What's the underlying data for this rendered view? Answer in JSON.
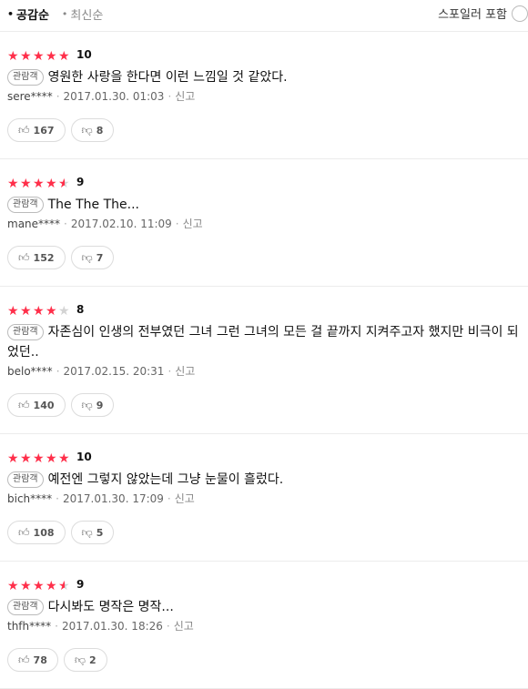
{
  "sort": {
    "active": "공감순",
    "inactive": "최신순",
    "dot": "•"
  },
  "spoiler": {
    "label": "스포일러 포함"
  },
  "colors": {
    "star": "#ff2f4a",
    "empty_star": "#d3d3d3"
  },
  "reviews": [
    {
      "score": "10",
      "rating": 5,
      "badge": "관람객",
      "text": "영원한 사랑을 한다면 이런 느낌일 것 같았다.",
      "user": "sere****",
      "date": "2017.01.30. 01:03",
      "report": "신고",
      "likes": "167",
      "dislikes": "8"
    },
    {
      "score": "9",
      "rating": 4.5,
      "badge": "관람객",
      "text": "The The The...",
      "user": "mane****",
      "date": "2017.02.10. 11:09",
      "report": "신고",
      "likes": "152",
      "dislikes": "7"
    },
    {
      "score": "8",
      "rating": 4,
      "badge": "관람객",
      "text": "자존심이 인생의 전부였던 그녀 그런 그녀의 모든 걸 끝까지 지켜주고자 했지만 비극이 되었던..",
      "user": "belo****",
      "date": "2017.02.15. 20:31",
      "report": "신고",
      "likes": "140",
      "dislikes": "9"
    },
    {
      "score": "10",
      "rating": 5,
      "badge": "관람객",
      "text": "예전엔 그렇지 않았는데 그냥 눈물이 흘렀다.",
      "user": "bich****",
      "date": "2017.01.30. 17:09",
      "report": "신고",
      "likes": "108",
      "dislikes": "5"
    },
    {
      "score": "9",
      "rating": 4.5,
      "badge": "관람객",
      "text": "다시봐도 명작은 명작...",
      "user": "thfh****",
      "date": "2017.01.30. 18:26",
      "report": "신고",
      "likes": "78",
      "dislikes": "2"
    }
  ]
}
